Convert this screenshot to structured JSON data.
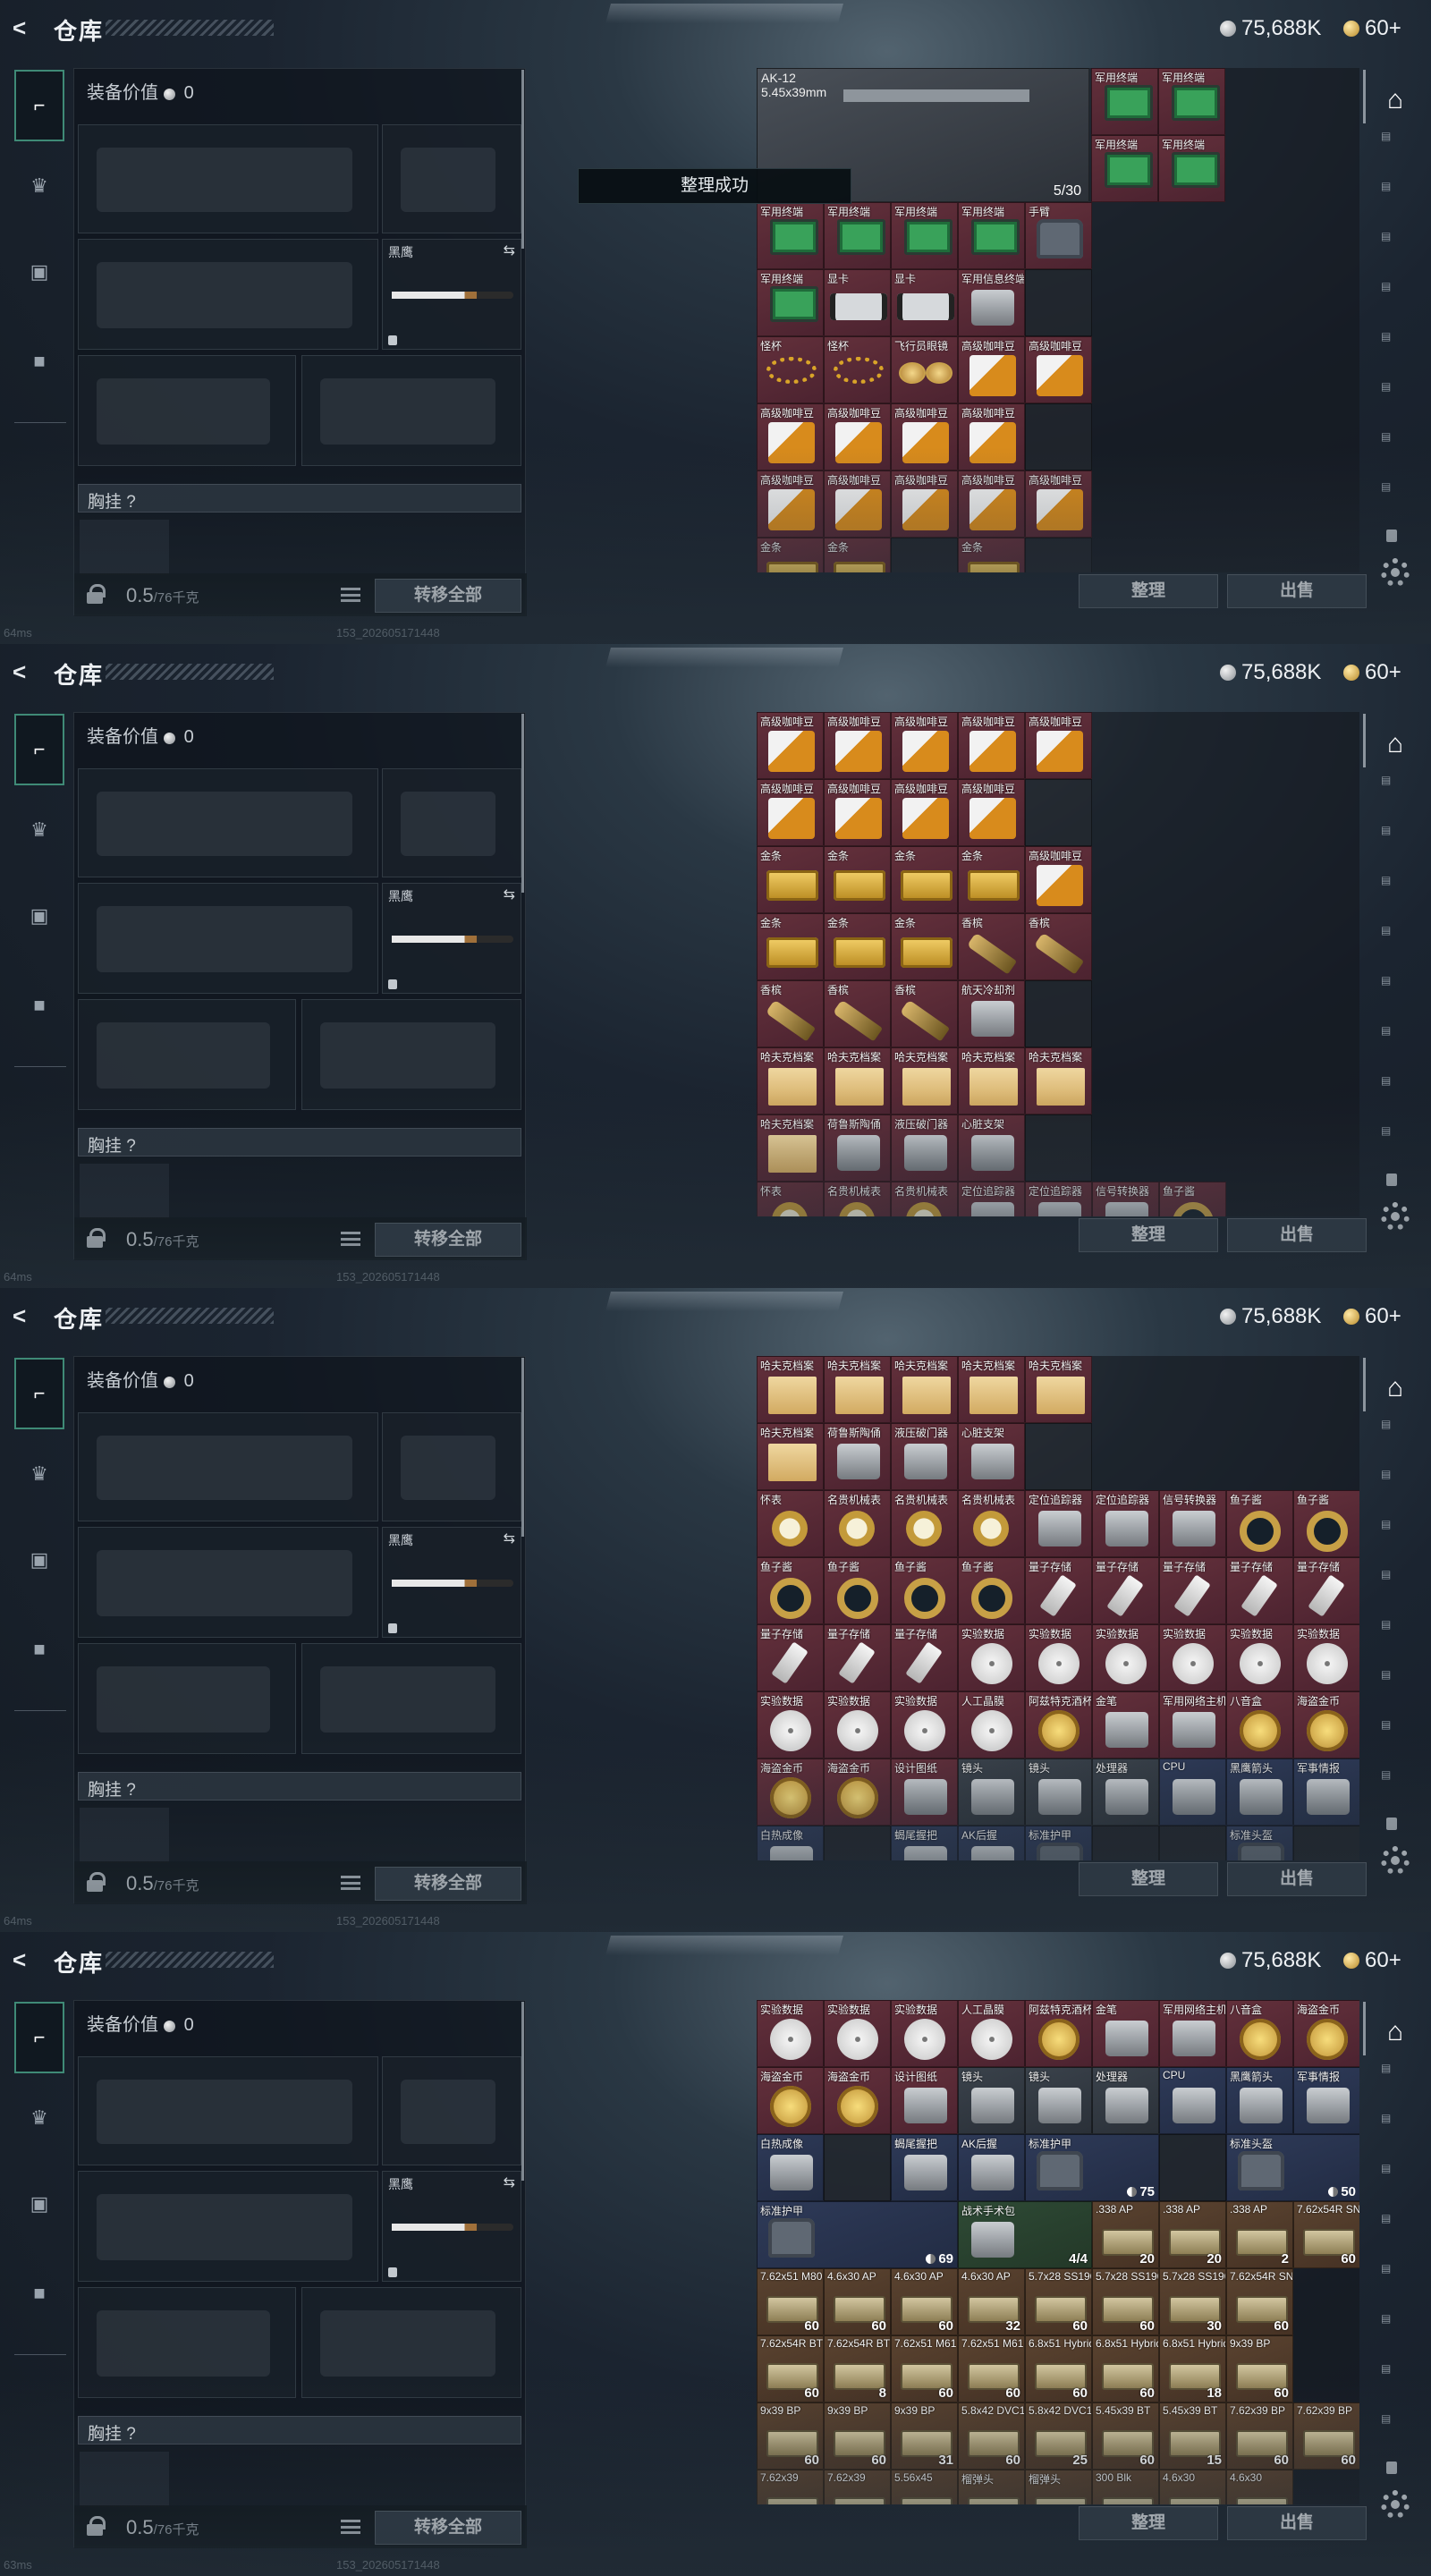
{
  "header": {
    "title": "仓库",
    "silver_amount": "75,688K",
    "gold_amount": "60+"
  },
  "equipment": {
    "value_label": "装备价值",
    "value": "0",
    "melee_name": "黑鹰",
    "chest_label": "胸挂 ?",
    "weight": "0.5",
    "weight_max": "/76千克",
    "transfer_all": "转移全部"
  },
  "footer": {
    "pings": [
      "64ms",
      "64ms",
      "64ms",
      "63ms"
    ],
    "uid": "153_202605171448"
  },
  "actions": {
    "sort": "整理",
    "sell": "出售"
  },
  "toast": "整理成功",
  "weapon": {
    "name": "AK-12",
    "caliber": "5.45x39mm",
    "ammo": "5/30"
  },
  "icons": {
    "back": "back-arrow-icon",
    "silver": "silver-coin-icon",
    "gold": "gold-coin-icon",
    "home": "home-icon",
    "settings": "gear-icon"
  },
  "screens": [
    {
      "rows": [
        [
          "军用终端",
          "军用终端"
        ],
        [
          "军用终端",
          "军用终端"
        ],
        [
          "军用终端",
          "军用终端",
          "军用终端",
          "军用终端",
          "手臂"
        ],
        [
          "军用终端",
          "显卡",
          "显卡",
          "军用信息终端",
          ""
        ],
        [
          "怪杯",
          "怪杯",
          "飞行员眼镜",
          "高级咖啡豆",
          "高级咖啡豆"
        ],
        [
          "高级咖啡豆",
          "高级咖啡豆",
          "高级咖啡豆",
          "高级咖啡豆",
          ""
        ],
        [
          "高级咖啡豆",
          "高级咖啡豆",
          "高级咖啡豆",
          "高级咖啡豆",
          "高级咖啡豆"
        ],
        [
          "金条",
          "金条",
          "",
          "金条",
          ""
        ]
      ]
    },
    {
      "rows": [
        [
          "高级咖啡豆",
          "高级咖啡豆",
          "高级咖啡豆",
          "高级咖啡豆",
          "高级咖啡豆"
        ],
        [
          "高级咖啡豆",
          "高级咖啡豆",
          "高级咖啡豆",
          "高级咖啡豆",
          ""
        ],
        [
          "金条",
          "金条",
          "金条",
          "金条",
          "高级咖啡豆"
        ],
        [
          "金条",
          "金条",
          "金条",
          "香槟",
          "香槟"
        ],
        [
          "香槟",
          "香槟",
          "香槟",
          "航天冷却剂",
          ""
        ],
        [
          "哈夫克档案",
          "哈夫克档案",
          "哈夫克档案",
          "哈夫克档案",
          "哈夫克档案"
        ],
        [
          "哈夫克档案",
          "荷鲁斯陶俑",
          "液压破门器",
          "心脏支架",
          ""
        ],
        [
          "怀表",
          "名贵机械表",
          "名贵机械表",
          "定位追踪器",
          "定位追踪器",
          "信号转换器",
          "鱼子酱"
        ]
      ]
    },
    {
      "rows": [
        [
          "哈夫克档案",
          "哈夫克档案",
          "哈夫克档案",
          "哈夫克档案",
          "哈夫克档案"
        ],
        [
          "哈夫克档案",
          "荷鲁斯陶俑",
          "液压破门器",
          "心脏支架",
          ""
        ],
        [
          "怀表",
          "名贵机械表",
          "名贵机械表",
          "名贵机械表",
          "定位追踪器",
          "定位追踪器",
          "信号转换器",
          "鱼子酱",
          "鱼子酱"
        ],
        [
          "鱼子酱",
          "鱼子酱",
          "鱼子酱",
          "鱼子酱",
          "量子存储",
          "量子存储",
          "量子存储",
          "量子存储",
          "量子存储"
        ],
        [
          "量子存储",
          "量子存储",
          "量子存储",
          "实验数据",
          "实验数据",
          "实验数据",
          "实验数据",
          "实验数据",
          "实验数据"
        ],
        [
          "实验数据",
          "实验数据",
          "实验数据",
          "人工晶膜",
          "阿兹特克酒杯",
          "金笔",
          "军用网络主机",
          "八音盒",
          "海盗金币"
        ],
        [
          "海盗金币",
          "海盗金币",
          "设计图纸",
          "镜头",
          "镜头",
          "处理器",
          "CPU",
          "黑鹰箭头",
          "军事情报"
        ],
        [
          "白热成像",
          "",
          "蝎尾握把",
          "AK后握",
          "标准护甲",
          "",
          "",
          "标准头盔",
          ""
        ]
      ]
    },
    {
      "rows": [
        [
          "实验数据",
          "实验数据",
          "实验数据",
          "人工晶膜",
          "阿兹特克酒杯",
          "金笔",
          "军用网络主机",
          "八音盒",
          "海盗金币"
        ],
        [
          "海盗金币",
          "海盗金币",
          "设计图纸",
          "镜头",
          "镜头",
          "处理器",
          "CPU",
          "黑鹰箭头",
          "军事情报"
        ],
        [
          "白热成像",
          "",
          "蝎尾握把",
          "AK后握",
          "标准护甲",
          "",
          "75",
          "标准头盔",
          "50"
        ],
        [
          "标准护甲",
          "69",
          "战术手术包",
          "4/4",
          ".338 AP",
          "20",
          ".338 AP",
          "20",
          ".338 AP",
          "2",
          "7.62x54R SNB",
          "60"
        ],
        [
          "7.62x51 M80",
          "60",
          "4.6x30 AP",
          "60",
          "4.6x30 AP",
          "60",
          "4.6x30 AP",
          "32",
          "5.7x28 SS190",
          "60",
          "5.7x28 SS190",
          "60",
          "5.7x28 SS190",
          "30",
          "7.62x54R SNB",
          "60"
        ],
        [
          "7.62x54R BT",
          "60",
          "7.62x54R BT",
          "8",
          "7.62x51 M61",
          "60",
          "7.62x51 M61",
          "60",
          "6.8x51 Hybrid",
          "60",
          "6.8x51 Hybrid",
          "60",
          "6.8x51 Hybrid",
          "18",
          "9x39 BP",
          "60"
        ],
        [
          "9x39 BP",
          "60",
          "9x39 BP",
          "60",
          "9x39 BP",
          "31",
          "5.8x42 DVC12",
          "60",
          "5.8x42 DVC12",
          "25",
          "5.45x39 BT",
          "60",
          "5.45x39 BT",
          "15",
          "7.62x39 BP",
          "60",
          "7.62x39 BP",
          "60"
        ],
        [
          "7.62x39",
          "7.62x39",
          "5.56x45",
          "榴弹头",
          "榴弹头",
          "300 Blk",
          "4.6x30",
          "4.6x30"
        ]
      ]
    }
  ]
}
